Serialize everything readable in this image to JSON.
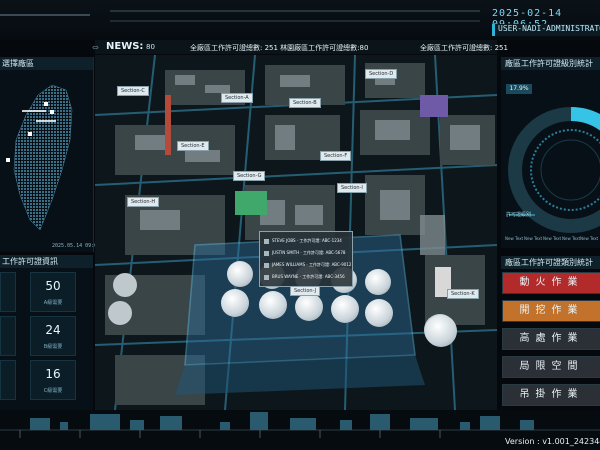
{
  "header": {
    "datetime": "2025-02-14 09:06:52",
    "user": "USER-NADI-ADMINISTRATOR"
  },
  "news": {
    "label": "NEWS:",
    "count": "80",
    "text1": "全廠區工作許可證總數: 251 林園廠區工作許可證總數:80",
    "text2": "全廠區工作許可證總數: 251"
  },
  "left_panel": {
    "map_title": "選擇廠區",
    "map_date": "2025.05.14 09:00:00",
    "permit_title": "工作許可證資訊",
    "stats": [
      {
        "value": "50",
        "label": "A級需要"
      },
      {
        "value": "24",
        "label": "B級需要"
      },
      {
        "value": "16",
        "label": "C級需要"
      }
    ]
  },
  "scene": {
    "sections": [
      {
        "label": "Section-C"
      },
      {
        "label": "Section-A"
      },
      {
        "label": "Section-B"
      },
      {
        "label": "Section-D"
      },
      {
        "label": "Section-E"
      },
      {
        "label": "Section-F"
      },
      {
        "label": "Section-G"
      },
      {
        "label": "Section-H"
      },
      {
        "label": "Section-I"
      },
      {
        "label": "Section-J"
      },
      {
        "label": "Section-K"
      }
    ],
    "tooltip": {
      "rows": [
        "STEVE JOBS · 工作許可證: ABC-1234",
        "JUSTIN SMITH · 工作許可證: ABC-5678",
        "JAMES WILLIAMS · 工作許可證: ABC-9012",
        "BRUS WAYNE · 工作許可證: ABC-3456"
      ]
    }
  },
  "right_panel": {
    "chart_title": "廠區工作許可證級別統計",
    "percent": "17.9%",
    "donut_label": "許可證級別",
    "axis_labels": [
      "New Text",
      "New Text",
      "New Text",
      "New Text",
      "New Text"
    ],
    "work_title": "廠區工作許可證類別統計",
    "work_types": [
      {
        "label": "動火作業",
        "color": "#b22a2a"
      },
      {
        "label": "開挖作業",
        "color": "#c2722a"
      },
      {
        "label": "高處作業",
        "color": "#2a3035"
      },
      {
        "label": "局限空間",
        "color": "#2a3035"
      },
      {
        "label": "吊掛作業",
        "color": "#2a3035"
      }
    ]
  },
  "footer": {
    "version": "Version : v1.001_24234473"
  }
}
